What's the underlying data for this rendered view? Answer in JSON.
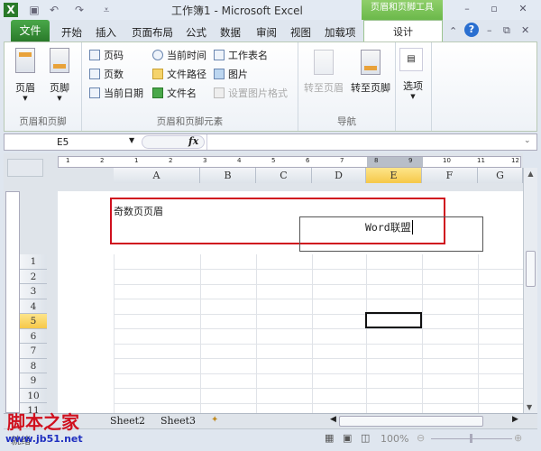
{
  "window": {
    "title": "工作簿1 - Microsoft Excel",
    "context_tab_group": "页眉和页脚工具"
  },
  "tabs": [
    "文件",
    "开始",
    "插入",
    "页面布局",
    "公式",
    "数据",
    "审阅",
    "视图",
    "加载项",
    "设计"
  ],
  "ribbon": {
    "groups": [
      {
        "label": "页眉和页脚",
        "buttons": [
          "页眉",
          "页脚"
        ]
      },
      {
        "label": "页眉和页脚元素",
        "buttons": [
          "页码",
          "页数",
          "当前日期",
          "当前时间",
          "文件路径",
          "文件名",
          "工作表名",
          "图片",
          "设置图片格式"
        ]
      },
      {
        "label": "导航",
        "buttons": [
          "转至页眉",
          "转至页脚"
        ]
      },
      {
        "label": "",
        "buttons": [
          "选项"
        ]
      }
    ]
  },
  "formula_bar": {
    "name_box": "E5",
    "fx": "fx",
    "value": ""
  },
  "columns": [
    "A",
    "B",
    "C",
    "D",
    "E",
    "F",
    "G"
  ],
  "rows": [
    "1",
    "2",
    "3",
    "4",
    "5",
    "6",
    "7",
    "8",
    "9",
    "10",
    "11"
  ],
  "ruler_marks": [
    "1",
    "2",
    "1",
    "2",
    "3",
    "4",
    "5",
    "6",
    "7",
    "8",
    "9",
    "10",
    "11",
    "12"
  ],
  "header": {
    "label": "奇数页页眉",
    "center_text": "Word联盟"
  },
  "sheet_tabs": [
    "Sheet2",
    "Sheet3"
  ],
  "status": {
    "ready": "就绪",
    "zoom": "100%"
  },
  "watermark": {
    "name": "脚本之家",
    "url": "www.jb51.net"
  },
  "colors": {
    "accent_green": "#2a7a2a",
    "highlight": "#c8102e",
    "selected_header": "#f6c849"
  }
}
